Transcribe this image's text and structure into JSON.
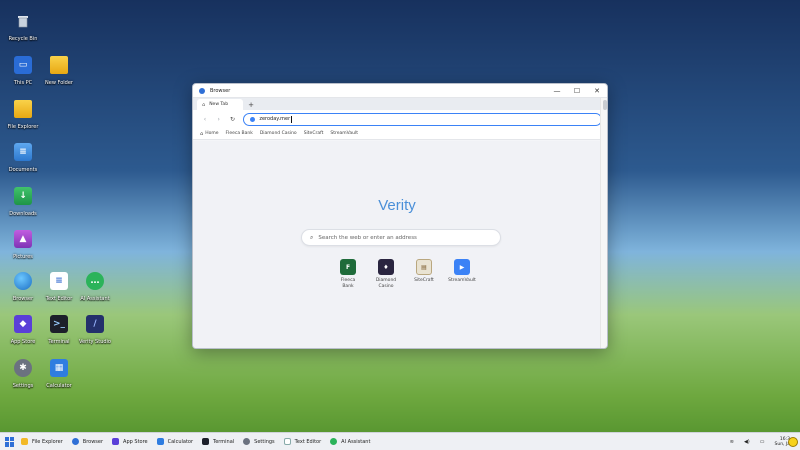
{
  "desktop": {
    "icons": [
      {
        "label": "Recycle Bin",
        "icon": "recycle-bin-icon"
      },
      {
        "label": "This PC",
        "icon": "computer-icon"
      },
      {
        "label": "New Folder",
        "icon": "folder-icon"
      },
      {
        "label": "File Explorer",
        "icon": "folder-icon"
      },
      {
        "label": "Documents",
        "icon": "documents-folder-icon"
      },
      {
        "label": "Downloads",
        "icon": "downloads-folder-icon"
      },
      {
        "label": "Pictures",
        "icon": "pictures-folder-icon"
      },
      {
        "label": "Browser",
        "icon": "globe-icon"
      },
      {
        "label": "Text Editor",
        "icon": "text-file-icon"
      },
      {
        "label": "AI Assistant",
        "icon": "chat-bubble-icon"
      },
      {
        "label": "App Store",
        "icon": "store-icon"
      },
      {
        "label": "Terminal",
        "icon": "terminal-icon"
      },
      {
        "label": "Verity Studio",
        "icon": "studio-icon"
      },
      {
        "label": "Settings",
        "icon": "gear-icon"
      },
      {
        "label": "Calculator",
        "icon": "calculator-icon"
      }
    ]
  },
  "window": {
    "title": "Browser",
    "tab": {
      "label": "New Tab"
    },
    "address": {
      "value": "zeroday.mer"
    },
    "bookmarks": [
      "Home",
      "Fleeca Bank",
      "Diamond Casino",
      "SiteCraft",
      "StreamVault"
    ],
    "logo": "Verity",
    "search": {
      "placeholder": "Search the web or enter an address"
    },
    "shortcuts": [
      {
        "label_1": "Fleeca",
        "label_2": "Bank",
        "glyph": "F",
        "color": "#1f6b3a"
      },
      {
        "label_1": "Diamond",
        "label_2": "Casino",
        "glyph": "♦",
        "color": "#2a2540"
      },
      {
        "label_1": "SiteCraft",
        "label_2": "",
        "glyph": "▤",
        "color": "#e9e3d2"
      },
      {
        "label_1": "StreamVault",
        "label_2": "",
        "glyph": "▶",
        "color": "#3b82f6"
      }
    ]
  },
  "taskbar": {
    "items": [
      "File Explorer",
      "Browser",
      "App Store",
      "Calculator",
      "Terminal",
      "Settings",
      "Text Editor",
      "AI Assistant"
    ],
    "clock_time": "16:3",
    "clock_date": "Sun, Ja"
  }
}
